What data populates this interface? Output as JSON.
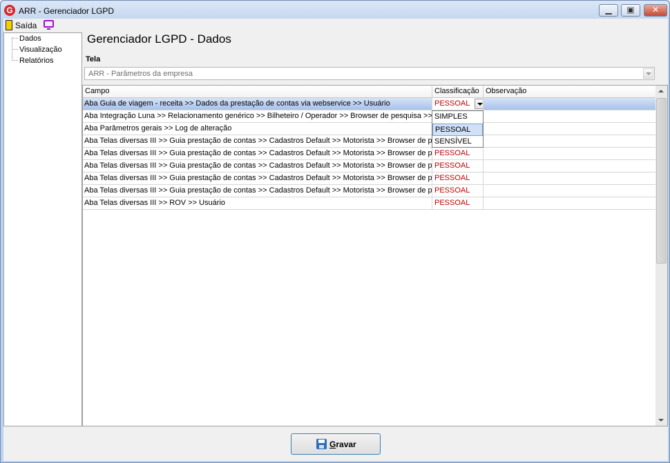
{
  "window": {
    "title": "ARR - Gerenciador LGPD",
    "app_icon": "G",
    "minimize_glyph": "▁",
    "maximize_glyph": "▣",
    "close_glyph": "✕"
  },
  "menu": {
    "exit_label": "Saída",
    "exit_icon": "exit-door-icon",
    "monitor_icon": "monitor-icon"
  },
  "sidebar": {
    "items": [
      {
        "label": "Dados"
      },
      {
        "label": "Visualização"
      },
      {
        "label": "Relatórios"
      }
    ]
  },
  "main": {
    "title": "Gerenciador LGPD - Dados",
    "tela_label": "Tela",
    "tela_value": "ARR - Parâmetros da empresa"
  },
  "grid": {
    "columns": [
      "Campo",
      "Classificação",
      "Observação"
    ],
    "rows": [
      {
        "campo": "Aba Guia de viagem - receita >> Dados da prestação de contas via webservice >> Usuário",
        "classificacao": "PESSOAL",
        "observacao": ""
      },
      {
        "campo": "Aba Integração Luna >> Relacionamento genérico >> Bilheteiro / Operador >> Browser de pesquisa >> ...",
        "classificacao": "",
        "observacao": ""
      },
      {
        "campo": "Aba Parâmetros gerais >> Log de alteração",
        "classificacao": "",
        "observacao": ""
      },
      {
        "campo": "Aba Telas diversas III >> Guia prestação de contas >> Cadastros Default >> Motorista >> Browser de pe...",
        "classificacao": "",
        "observacao": ""
      },
      {
        "campo": "Aba Telas diversas III >> Guia prestação de contas >> Cadastros Default >> Motorista >> Browser de pe...",
        "classificacao": "PESSOAL",
        "observacao": ""
      },
      {
        "campo": "Aba Telas diversas III >> Guia prestação de contas >> Cadastros Default >> Motorista >> Browser de pe...",
        "classificacao": "PESSOAL",
        "observacao": ""
      },
      {
        "campo": "Aba Telas diversas III >> Guia prestação de contas >> Cadastros Default >> Motorista >> Browser de pe...",
        "classificacao": "PESSOAL",
        "observacao": ""
      },
      {
        "campo": "Aba Telas diversas III >> Guia prestação de contas >> Cadastros Default >> Motorista >> Browser de pe...",
        "classificacao": "PESSOAL",
        "observacao": ""
      },
      {
        "campo": "Aba Telas diversas III >> ROV >> Usuário",
        "classificacao": "PESSOAL",
        "observacao": ""
      }
    ],
    "dropdown_options": [
      "SIMPLES",
      "PESSOAL",
      "SENSÍVEL"
    ],
    "dropdown_highlighted": "PESSOAL"
  },
  "footer": {
    "save_label_mnemonic": "G",
    "save_label_rest": "ravar"
  },
  "colors": {
    "classification_text": "#c00000",
    "selected_row": "#a8c2ea",
    "titlebar": "#c3d6ef"
  }
}
